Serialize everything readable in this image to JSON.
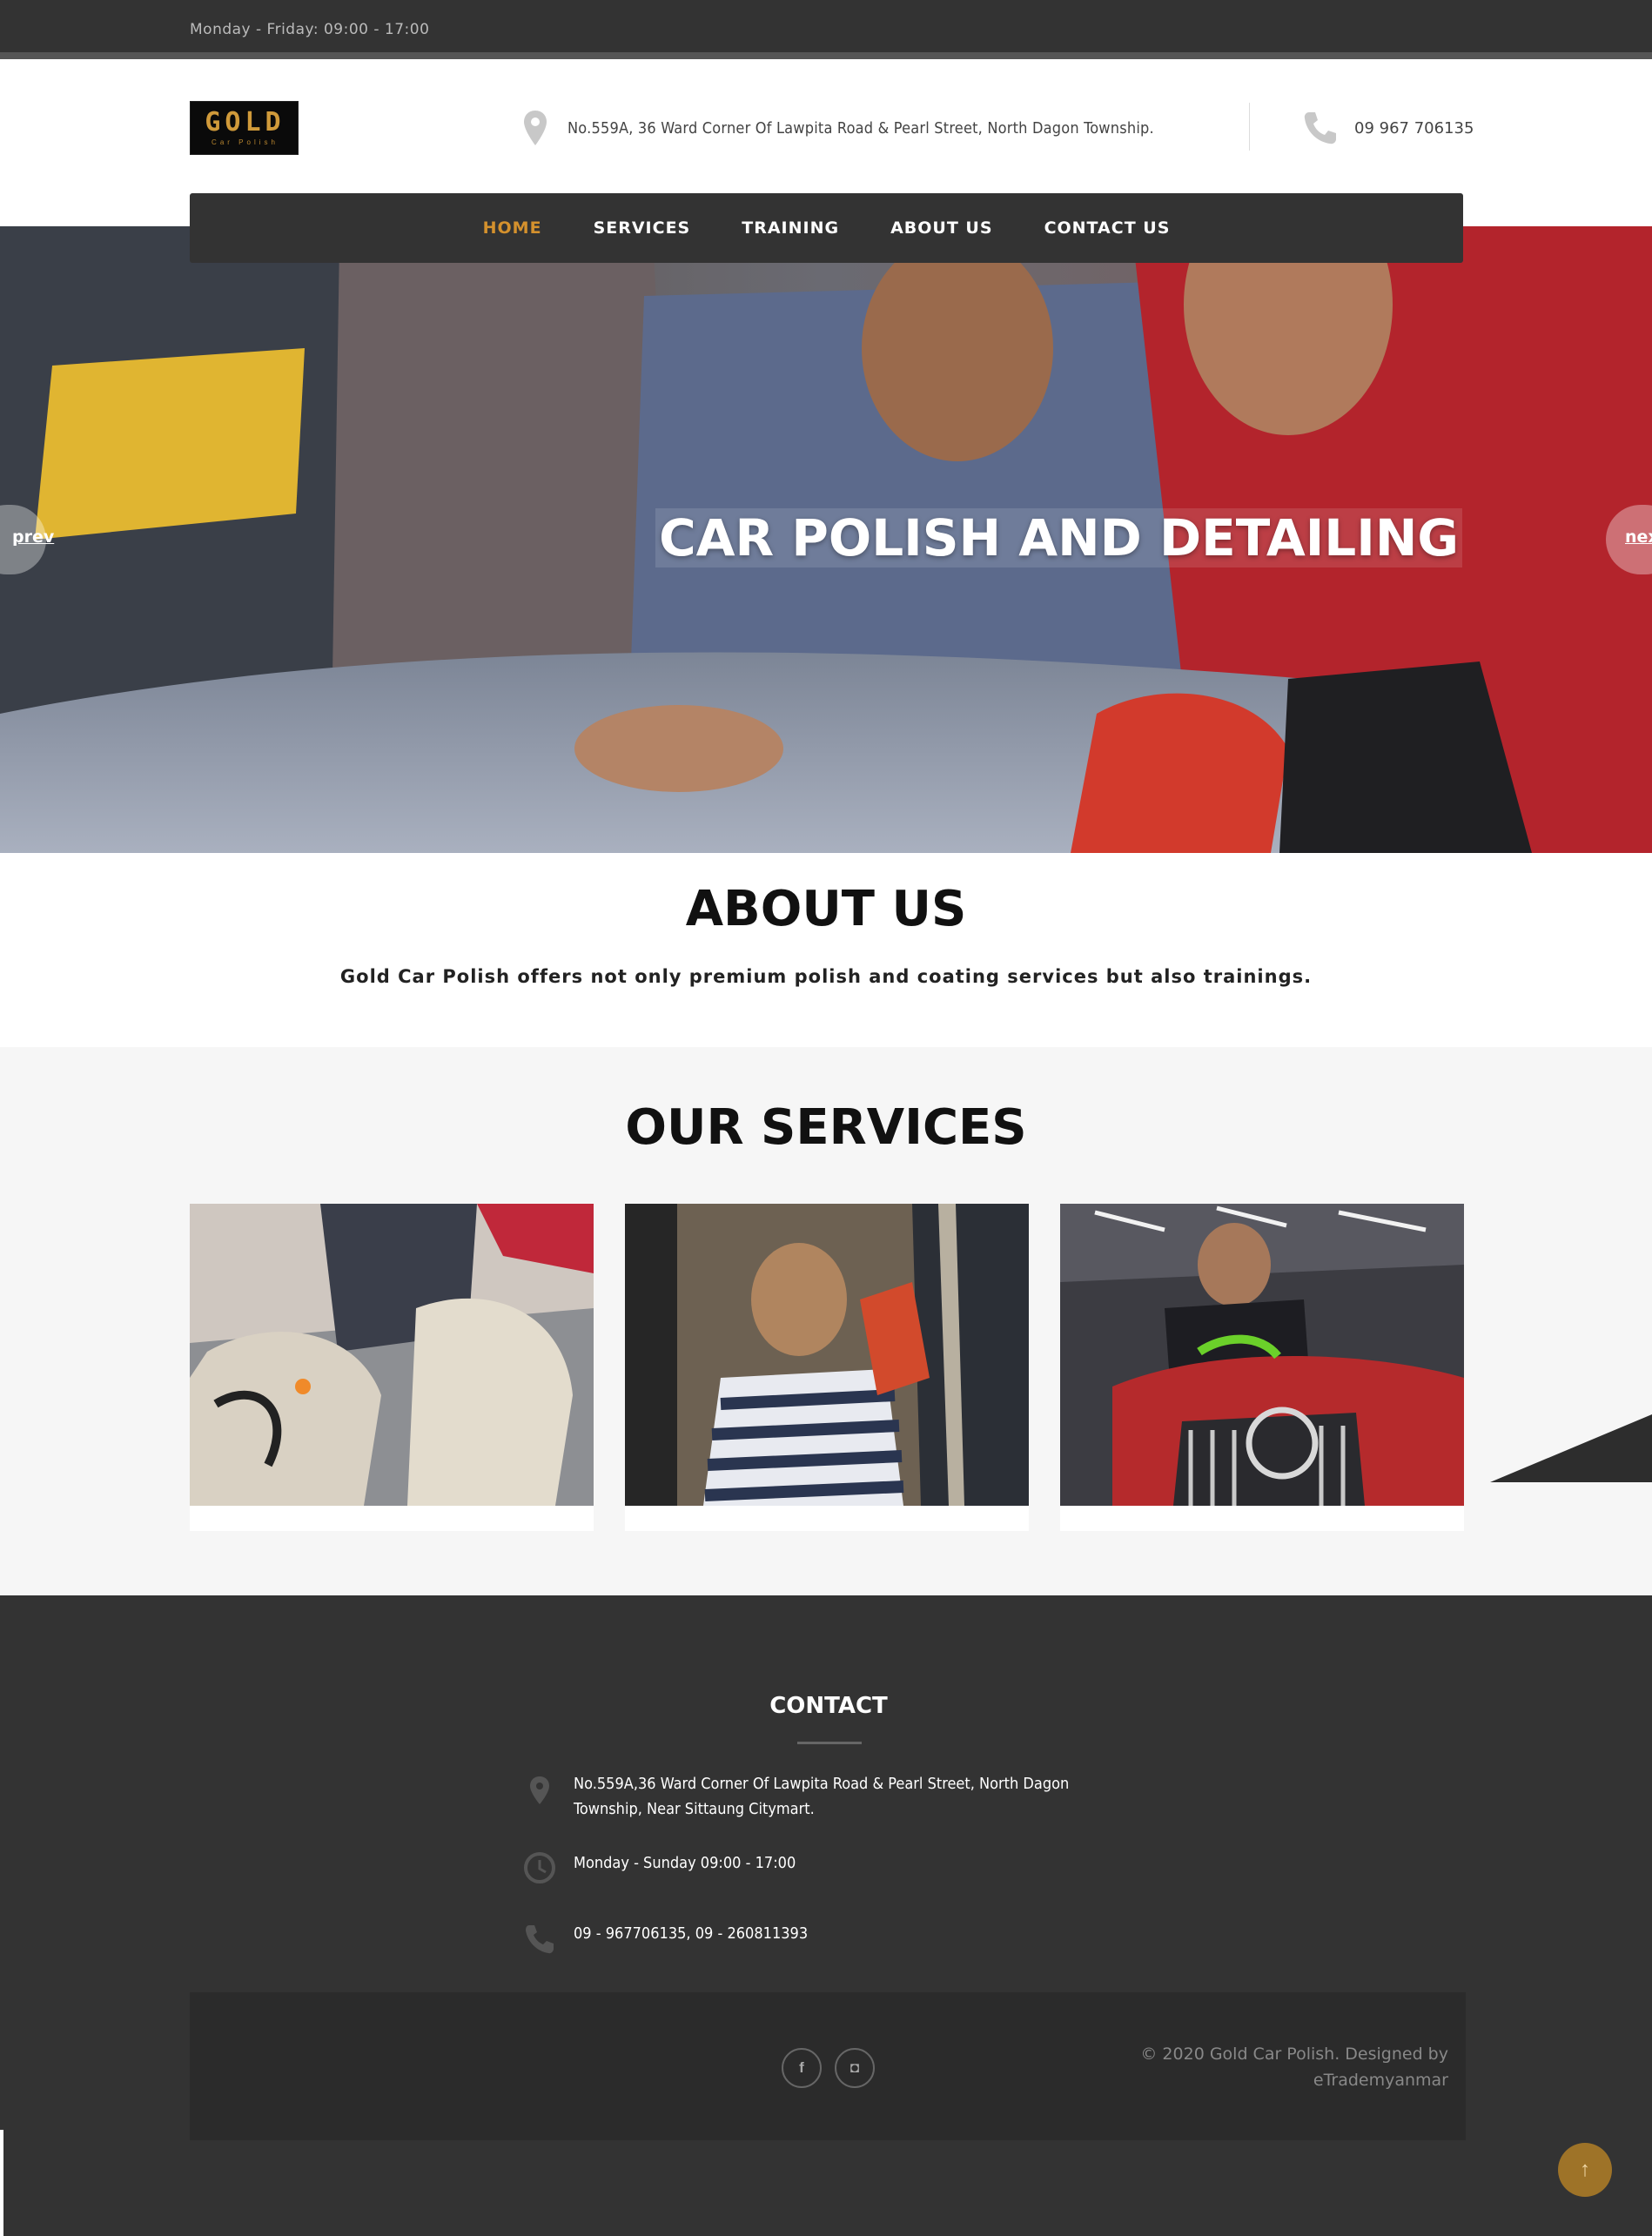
{
  "topbar": {
    "hours": "Monday - Friday: 09:00 - 17:00"
  },
  "header": {
    "logo_text": "GOLD",
    "logo_sub": "Car Polish",
    "address": "No.559A, 36 Ward Corner Of Lawpita Road & Pearl Street, North Dagon Township.",
    "phone": "09 967 706135",
    "icons": [
      "map-pin-icon",
      "phone-icon"
    ]
  },
  "nav": {
    "items": [
      {
        "label": "HOME",
        "active": true
      },
      {
        "label": "SERVICES"
      },
      {
        "label": "TRAINING"
      },
      {
        "label": "ABOUT US"
      },
      {
        "label": "CONTACT US"
      }
    ],
    "accent": "#d4912d"
  },
  "hero": {
    "title": "CAR POLISH AND DETAILING",
    "prev": "prev",
    "next": "next"
  },
  "about": {
    "title": "ABOUT US",
    "text": "Gold Car Polish offers not only premium polish and coating services but also trainings."
  },
  "services": {
    "title": "OUR SERVICES"
  },
  "contact": {
    "title": "CONTACT",
    "address_line1": "No.559A,36 Ward Corner Of Lawpita Road & Pearl Street, North Dagon",
    "address_line2": "Township, Near Sittaung Citymart.",
    "hours": "Monday - Sunday  09:00 - 17:00",
    "phones": "09 - 967706135, 09 - 260811393",
    "icons": [
      "map-pin-icon",
      "clock-icon",
      "phone-icon"
    ]
  },
  "footer": {
    "social": [
      {
        "icon": "facebook-icon",
        "glyph": "f"
      },
      {
        "icon": "instagram-icon",
        "glyph": "◘"
      }
    ],
    "copy_line1": "© 2020 Gold Car Polish.  Designed by",
    "copy_line2": "eTrademyanmar",
    "totop_glyph": "↑"
  },
  "colors": {
    "dark": "#333333",
    "gold": "#d4912d",
    "light_bg": "#f6f6f6"
  }
}
